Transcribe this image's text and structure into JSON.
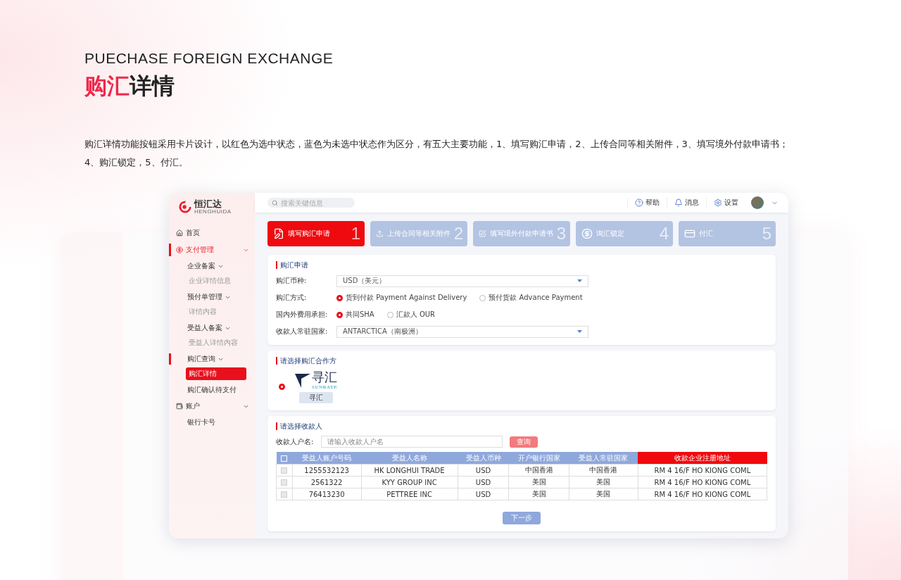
{
  "header": {
    "title_en": "PUECHASE FOREIGN EXCHANGE",
    "title_accent": "购汇",
    "title_rest": "详情",
    "description": "购汇详情功能按钮采用卡片设计，以红色为选中状态，蓝色为未选中状态作为区分，有五大主要功能，1、填写购汇申请，2、上传合同等相关附件，3、填写境外付款申请书；4、购汇锁定，5、付汇。"
  },
  "app": {
    "logo": {
      "name": "恒汇达",
      "sub": "HENGHUIDA"
    },
    "search": {
      "placeholder": "搜索关键信息"
    },
    "top_actions": [
      {
        "kind": "help",
        "label": "帮助"
      },
      {
        "kind": "bell",
        "label": "消息"
      },
      {
        "kind": "settings",
        "label": "设置"
      }
    ],
    "sidebar": [
      {
        "kind": "home",
        "label": "首页",
        "selected": false
      },
      {
        "kind": "payment",
        "label": "支付管理",
        "selected": true,
        "expanded": true,
        "children": [
          {
            "label": "企业备案",
            "selected": false,
            "expanded": true,
            "children": [
              {
                "label": "企业详情信息",
                "selected": false
              }
            ]
          },
          {
            "label": "预付单管理",
            "selected": false,
            "expanded": true,
            "children": [
              {
                "label": "详情内容",
                "selected": false
              }
            ]
          },
          {
            "label": "受益人备案",
            "selected": false,
            "expanded": true,
            "children": [
              {
                "label": "受益人详情内容",
                "selected": false
              }
            ]
          },
          {
            "label": "购汇查询",
            "selected": true,
            "expanded": true,
            "children": [
              {
                "label": "购汇详情",
                "selected": true
              }
            ]
          },
          {
            "label": "购汇确认待支付",
            "selected": false
          }
        ]
      },
      {
        "kind": "account",
        "label": "账户",
        "selected": false,
        "expanded": true,
        "children": [
          {
            "label": "银行卡号",
            "selected": false
          }
        ]
      }
    ],
    "steps": [
      {
        "kind": "apply",
        "label": "填写购汇申请",
        "number": "1",
        "selected": true
      },
      {
        "kind": "upload",
        "label": "上传合同等相关附件",
        "number": "2",
        "selected": false
      },
      {
        "kind": "form",
        "label": "填写境外付款申请书",
        "number": "3",
        "selected": false
      },
      {
        "kind": "lock",
        "label": "询汇锁定",
        "number": "4",
        "selected": false
      },
      {
        "kind": "pay",
        "label": "付汇",
        "number": "5",
        "selected": false
      }
    ],
    "application": {
      "title": "购汇申请",
      "fields": [
        {
          "kind": "select",
          "label": "购汇币种:",
          "value": "USD（美元）"
        },
        {
          "kind": "radio",
          "label": "购汇方式:",
          "options": [
            {
              "label": "货到付款 Payment Against Delivery",
              "selected": true
            },
            {
              "label": "预付货款 Advance Payment",
              "selected": false
            }
          ]
        },
        {
          "kind": "radio",
          "label": "国内外费用承担:",
          "options": [
            {
              "label": "共同SHA",
              "selected": true
            },
            {
              "label": "汇款人 OUR",
              "selected": false
            }
          ]
        },
        {
          "kind": "select",
          "label": "收款人常驻国家:",
          "value": "ANTARCTICA（南极洲）"
        }
      ]
    },
    "partner": {
      "title": "请选择购汇合作方",
      "partners": [
        {
          "logo_text": "寻汇",
          "logo_sub": "SUNRATE",
          "name": "寻汇",
          "selected": true
        }
      ]
    },
    "payee": {
      "title": "请选择收款人",
      "search_label": "收款人户名:",
      "placeholder": "请输入收款人户名",
      "search_button": "查询",
      "header_checked": false,
      "columns": [
        {
          "label": "受益人账户号码",
          "highlighted": false
        },
        {
          "label": "受益人名称",
          "highlighted": false
        },
        {
          "label": "受益人币种",
          "highlighted": false
        },
        {
          "label": "开户银行国家",
          "highlighted": false
        },
        {
          "label": "受益人常驻国家",
          "highlighted": false
        },
        {
          "label": "收款企业注册地址",
          "highlighted": true
        }
      ],
      "rows": [
        {
          "checked": false,
          "cells": [
            "1255532123",
            "HK LONGHUI TRADE",
            "USD",
            "中国香港",
            "中国香港",
            "RM 4 16/F HO KIONG COML"
          ]
        },
        {
          "checked": false,
          "cells": [
            "2561322",
            "KYY GROUP INC",
            "USD",
            "美国",
            "美国",
            "RM 4 16/F HO KIONG COML"
          ]
        },
        {
          "checked": false,
          "cells": [
            "76413230",
            "PETTREE INC",
            "USD",
            "美国",
            "美国",
            "RM 4 16/F HO KIONG COML"
          ]
        }
      ],
      "next_button": "下一步"
    }
  }
}
